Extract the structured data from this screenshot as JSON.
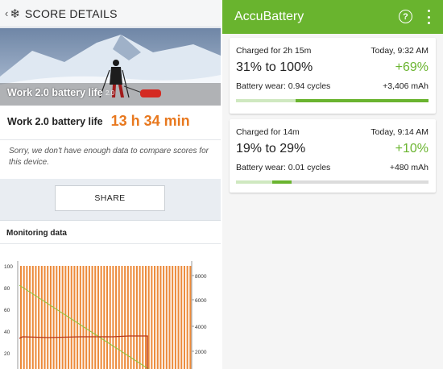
{
  "pcmark": {
    "header": {
      "back_icon": "chevron-left-icon",
      "logo_icon": "snowflake-icon",
      "title": "SCORE DETAILS"
    },
    "hero": {
      "label": "Work 2.0 battery life",
      "score": "2.0"
    },
    "result": {
      "label": "Work 2.0 battery life",
      "value": "13 h 34 min",
      "value_color": "#e8781e"
    },
    "note": "Sorry, we don't have enough data to compare scores for this device.",
    "share_label": "SHARE",
    "monitoring": {
      "title": "Monitoring data",
      "left_ticks": [
        "100",
        "80",
        "60",
        "40",
        "20"
      ],
      "right_ticks": [
        "8000",
        "6000",
        "4000",
        "2000"
      ]
    }
  },
  "accubattery": {
    "app_title": "AccuBattery",
    "help_icon": "help-circle-icon",
    "menu_icon": "more-vert-icon",
    "accent": "#6ab42f",
    "sessions": [
      {
        "duration": "Charged for 2h 15m",
        "time": "Today, 9:32 AM",
        "range": "31% to 100%",
        "delta": "+69%",
        "wear": "Battery wear: 0.94 cycles",
        "capacity": "+3,406 mAh",
        "from_pct": 31,
        "to_pct": 100
      },
      {
        "duration": "Charged for 14m",
        "time": "Today, 9:14 AM",
        "range": "19% to 29%",
        "delta": "+10%",
        "wear": "Battery wear: 0.01 cycles",
        "capacity": "+480 mAh",
        "from_pct": 19,
        "to_pct": 29
      }
    ]
  }
}
